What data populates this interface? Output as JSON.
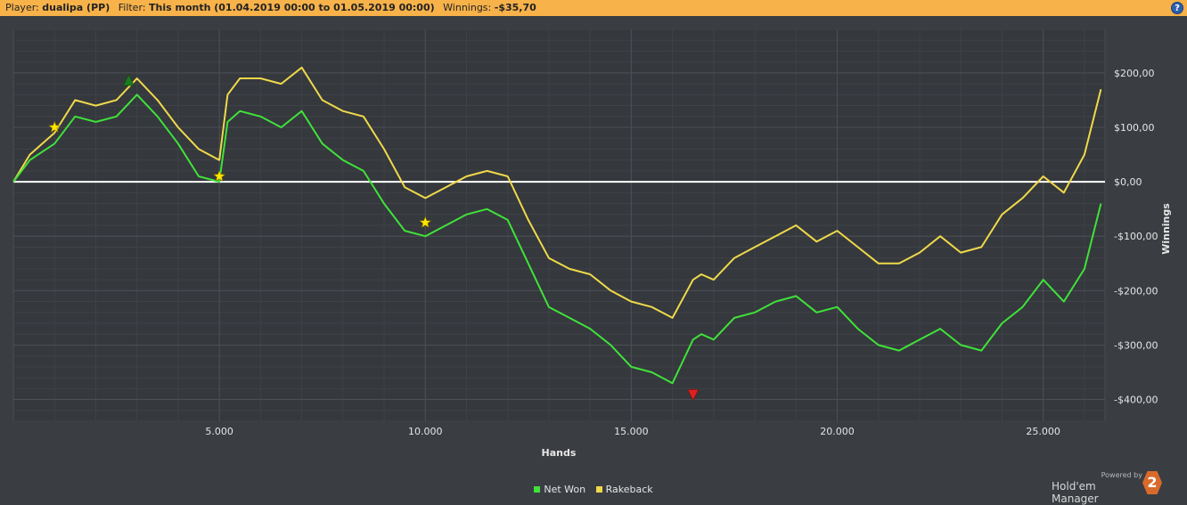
{
  "header": {
    "player_label": "Player:",
    "player_value": "dualipa (PP)",
    "filter_label": "Filter:",
    "filter_value": "This month (01.04.2019 00:00 to 01.05.2019 00:00)",
    "winnings_label": "Winnings:",
    "winnings_value": "-$35,70",
    "help_glyph": "?"
  },
  "branding": {
    "powered_by": "Powered by",
    "product": "Hold'em Manager",
    "logo_text": "2"
  },
  "chart_data": {
    "type": "line",
    "xlabel": "Hands",
    "ylabel": "Winnings",
    "xlim": [
      0,
      26500
    ],
    "ylim": [
      -440,
      280
    ],
    "x_ticks": [
      5000,
      10000,
      15000,
      20000,
      25000
    ],
    "x_tick_labels": [
      "5.000",
      "10.000",
      "15.000",
      "20.000",
      "25.000"
    ],
    "y_ticks": [
      200,
      100,
      0,
      -100,
      -200,
      -300,
      -400
    ],
    "y_tick_labels": [
      "$200,00",
      "$100,00",
      "$0,00",
      "-$100,00",
      "-$200,00",
      "-$300,00",
      "-$400,00"
    ],
    "grid": true,
    "legend_position": "bottom-center",
    "zero_line_color": "#ffffff",
    "x": [
      0,
      400,
      1000,
      1500,
      2000,
      2500,
      3000,
      3500,
      4000,
      4500,
      5000,
      5200,
      5500,
      6000,
      6500,
      7000,
      7500,
      8000,
      8500,
      9000,
      9500,
      10000,
      10500,
      11000,
      11500,
      12000,
      12500,
      13000,
      13500,
      14000,
      14500,
      15000,
      15500,
      16000,
      16500,
      16700,
      17000,
      17500,
      18000,
      18500,
      19000,
      19500,
      20000,
      20500,
      21000,
      21500,
      22000,
      22500,
      23000,
      23500,
      24000,
      24500,
      25000,
      25500,
      26000,
      26400
    ],
    "series": [
      {
        "name": "Net Won",
        "color": "#3fe23a",
        "values": [
          0,
          40,
          70,
          120,
          110,
          120,
          160,
          120,
          70,
          10,
          0,
          110,
          130,
          120,
          100,
          130,
          70,
          40,
          20,
          -40,
          -90,
          -100,
          -80,
          -60,
          -50,
          -70,
          -150,
          -230,
          -250,
          -270,
          -300,
          -340,
          -350,
          -370,
          -290,
          -280,
          -290,
          -250,
          -240,
          -220,
          -210,
          -240,
          -230,
          -270,
          -300,
          -310,
          -290,
          -270,
          -300,
          -310,
          -260,
          -230,
          -180,
          -220,
          -160,
          -40
        ]
      },
      {
        "name": "Rakeback",
        "color": "#efd94a",
        "values": [
          0,
          50,
          90,
          150,
          140,
          150,
          190,
          150,
          100,
          60,
          40,
          160,
          190,
          190,
          180,
          210,
          150,
          130,
          120,
          60,
          -10,
          -30,
          -10,
          10,
          20,
          10,
          -70,
          -140,
          -160,
          -170,
          -200,
          -220,
          -230,
          -250,
          -180,
          -170,
          -180,
          -140,
          -120,
          -100,
          -80,
          -110,
          -90,
          -120,
          -150,
          -150,
          -130,
          -100,
          -130,
          -120,
          -60,
          -30,
          10,
          -20,
          50,
          170
        ]
      }
    ],
    "markers": [
      {
        "series": "Net Won",
        "x": 1000,
        "y": 100,
        "symbol": "star",
        "color": "#ffe600"
      },
      {
        "series": "Net Won",
        "x": 2800,
        "y": 185,
        "symbol": "triangle-up",
        "color": "#1e7a1e"
      },
      {
        "series": "Net Won",
        "x": 5000,
        "y": 10,
        "symbol": "star",
        "color": "#ffe600"
      },
      {
        "series": "Net Won",
        "x": 10000,
        "y": -75,
        "symbol": "star",
        "color": "#ffe600"
      },
      {
        "series": "Net Won",
        "x": 16500,
        "y": -390,
        "symbol": "triangle-down",
        "color": "#e02020"
      }
    ]
  }
}
